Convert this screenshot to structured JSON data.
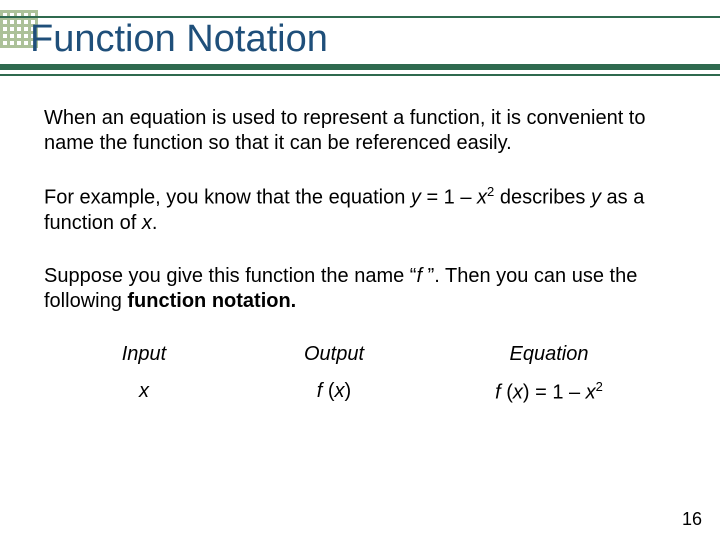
{
  "title": "Function Notation",
  "paragraphs": {
    "p1": "When an equation is used to represent a function, it is convenient to name the function so that it can be referenced easily.",
    "p2_a": "For example, you know that the equation ",
    "p2_eq_y": "y",
    "p2_eq_mid": " = 1 – ",
    "p2_eq_x": "x",
    "p2_eq_exp": "2",
    "p2_b": " describes ",
    "p2_y2": "y",
    "p2_c": " as a function of ",
    "p2_x2": "x",
    "p2_d": ".",
    "p3_a": "Suppose you give this function the name “",
    "p3_f": "f",
    "p3_b": " ”. Then you can use the following ",
    "p3_bold": "function notation."
  },
  "columns": {
    "head1": "Input",
    "head2": "Output",
    "head3": "Equation",
    "val1": "x",
    "val2_f": "f",
    "val2_p": " (",
    "val2_x": "x",
    "val2_c": ")",
    "val3_f": "f",
    "val3_p": " (",
    "val3_x": "x",
    "val3_c": ") = 1 – ",
    "val3_x2": "x",
    "val3_exp": "2"
  },
  "page_number": "16"
}
